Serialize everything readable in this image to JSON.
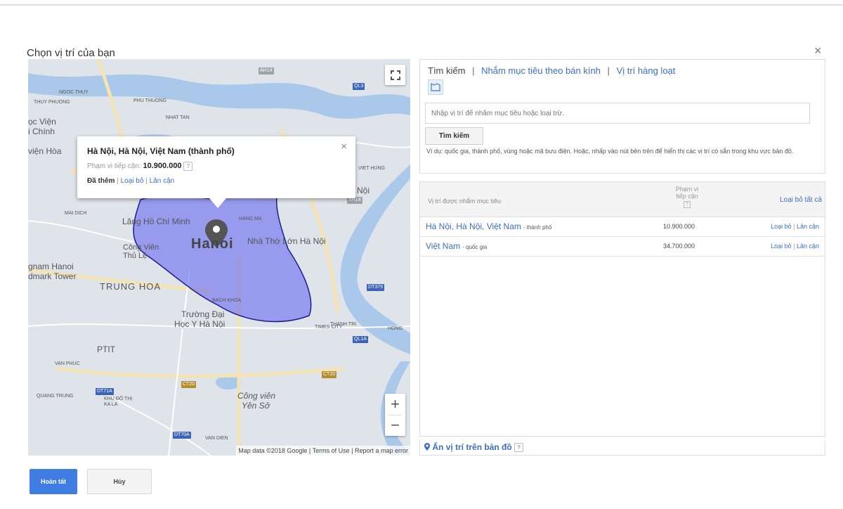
{
  "dialog": {
    "title": "Chọn vị trí của bạn",
    "close_symbol": "×"
  },
  "map": {
    "labels": {
      "hanoi": "Hanoi",
      "trung_hoa": "TRUNG HOA",
      "ptit": "PTIT",
      "lang_ho_chi_minh": "Lăng Hồ Chí Minh",
      "nha_tho_lon": "Nhà Thờ Lớn Hà Nội",
      "cong_vien_thu_le": "Công Viên Thủ Lệ",
      "keangnam": "gnam Hanoi",
      "landmark": "dmark Tower",
      "truong_dh": "Trường Đại",
      "hoc_y": "Học Y Hà Nội",
      "cong_vien_yen_so_1": "Công viên",
      "cong_vien_yen_so_2": "Yên Sở",
      "hoc_vien": "ọc Viện",
      "chinh": "i Chính",
      "vien_hoa": "viện Hòa",
      "noi": "Nội",
      "hang_ma": "HANG MA",
      "bach_khoa": "BACH KHOA",
      "mai_dich": "MAI DICH",
      "phu_thuong": "PHU THUONG",
      "van_phuc": "VAN PHUC",
      "quang_trung": "QUANG TRUNG",
      "khu_do_thi": "KHU ĐÔ THỊ KA LA",
      "thuy_phuong": "THUY PHUONG",
      "nhat_tan": "NHAT TAN",
      "times_city": "TIMES CITY",
      "thanh_tri": "THANH TRI",
      "hong": "HONG",
      "viet_hung": "VIET HUNG",
      "van_dien": "VAN DIEN",
      "ngoc_thuy": "NGOC THUY"
    },
    "road_tags": {
      "ah14": "AH14",
      "ql3": "QL3",
      "ah14b": "AH14",
      "dt379": "DT379",
      "ql1a": "QL1A",
      "ct20a": "CT20",
      "ct20b": "CT20",
      "dt71a": "DT71A",
      "dt70a": "DT70A"
    },
    "attribution": {
      "data": "Map data ©2018 Google",
      "terms": "Terms of Use",
      "report": "Report a map error"
    },
    "popup": {
      "title": "Hà Nội, Hà Nội, Việt Nam (thành phố)",
      "reach_label": "Phạm vi tiếp cận:",
      "reach_value": "10.900.000",
      "help": "?",
      "add": "Đã thêm",
      "remove": "Loại bỏ",
      "nearby": "Lân cận",
      "separator": "|",
      "close": "×"
    },
    "controls": {
      "zoom_in": "+",
      "zoom_out": "−"
    }
  },
  "search_panel": {
    "tabs": {
      "search": "Tìm kiếm",
      "radius": "Nhắm mục tiêu theo bán kính",
      "bulk": "Vị trí hàng loạt",
      "separator": "|"
    },
    "input_placeholder": "Nhập vị trí để nhắm mục tiêu hoặc loại trừ.",
    "search_button": "Tìm kiếm",
    "hint": "Ví dụ: quốc gia, thành phố, vùng hoặc mã bưu điện. Hoặc, nhấp vào nút bên trên để hiển thị các vị trí có sẵn trong khu vực bản đồ."
  },
  "targeted": {
    "header": {
      "location": "Vị trí được nhắm mục tiêu",
      "reach_line1": "Phạm vi",
      "reach_line2": "tiếp cận",
      "reach_help": "?",
      "remove_all": "Loại bỏ tất cả"
    },
    "rows": [
      {
        "name": "Hà Nội, Hà Nội, Việt Nam",
        "type": "- thành phố",
        "reach": "10.900.000",
        "remove": "Loại bỏ",
        "sep": "|",
        "nearby": "Lân cận"
      },
      {
        "name": "Việt Nam",
        "type": "- quốc gia",
        "reach": "34.700.000",
        "remove": "Loại bỏ",
        "sep": "|",
        "nearby": "Lân cận"
      }
    ],
    "hide_on_map": "Ẩn vị trí trên bản đồ",
    "hide_help": "?"
  },
  "footer": {
    "done": "Hoàn tất",
    "cancel": "Hủy"
  },
  "colors": {
    "link": "#3b6ec4",
    "primary_button": "#3f7de3",
    "map_highlight": "#5c5cf0"
  }
}
